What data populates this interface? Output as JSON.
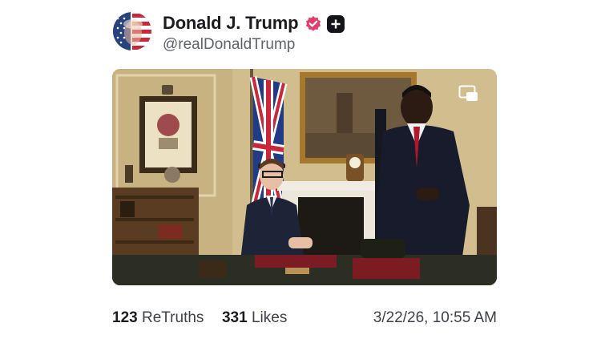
{
  "author": {
    "name": "Donald J. Trump",
    "handle": "@realDonaldTrump",
    "verified_icon": "verified-check-icon",
    "verified_color": "#e23e6b",
    "badge_icon": "plus-icon"
  },
  "media": {
    "overlay_icon": "picture-in-picture-icon"
  },
  "stats": {
    "retruths_count": "123",
    "retruths_label": "ReTruths",
    "likes_count": "331",
    "likes_label": "Likes"
  },
  "timestamp": "3/22/26, 10:55 AM"
}
